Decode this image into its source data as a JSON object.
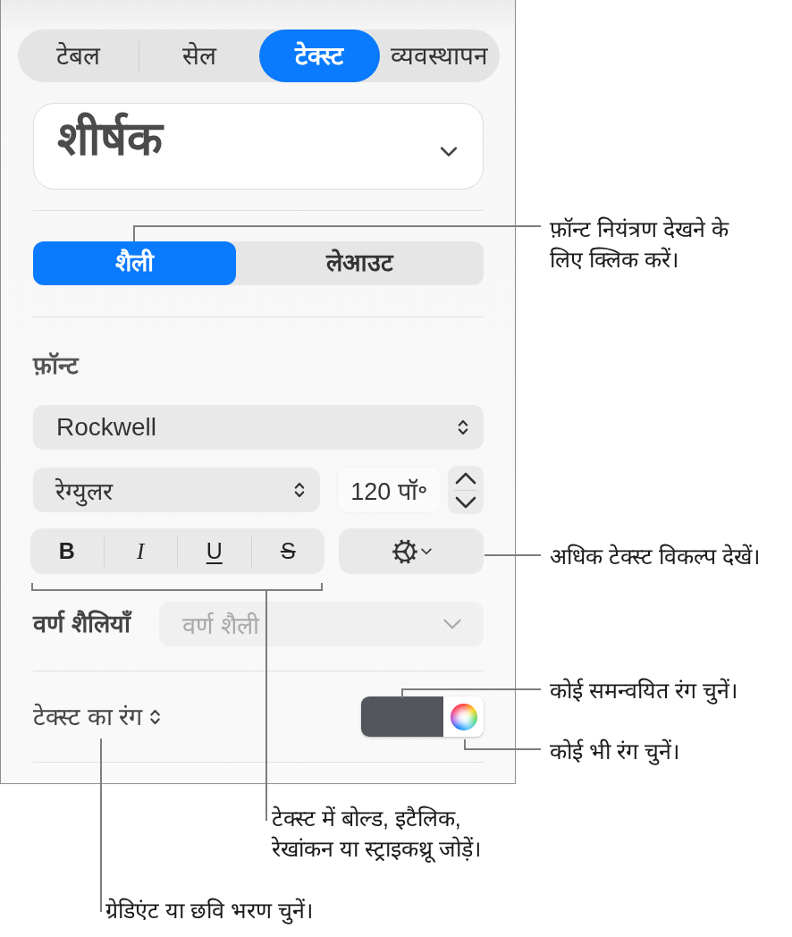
{
  "inspector": {
    "tabs": [
      {
        "label": "टेबल",
        "selected": false
      },
      {
        "label": "सेल",
        "selected": false
      },
      {
        "label": "टेक्स्ट",
        "selected": true
      },
      {
        "label": "व्यवस्थापन",
        "selected": false
      }
    ],
    "paragraph_style": {
      "value": "शीर्षक"
    },
    "subtabs": [
      {
        "label": "शैली",
        "selected": true
      },
      {
        "label": "लेआउट",
        "selected": false
      }
    ],
    "font_section": {
      "label": "फ़ॉन्ट",
      "font": "Rockwell",
      "typeface": "रेग्युलर",
      "size": "120 पॉ॰"
    },
    "format_buttons": [
      {
        "label": "B",
        "kind": "bold"
      },
      {
        "label": "I",
        "kind": "italic"
      },
      {
        "label": "U",
        "kind": "underline"
      },
      {
        "label": "S",
        "kind": "strikethrough"
      }
    ],
    "character_styles": {
      "label": "वर्ण शैलियाँ",
      "placeholder": "वर्ण शैली",
      "disabled": true
    },
    "text_color": {
      "label": "टेक्स्ट का रंग"
    }
  },
  "callouts": [
    {
      "text": "फ़ॉन्ट नियंत्रण देखने के लिए क्लिक करें।"
    },
    {
      "text": "अधिक टेक्स्ट विकल्प देखें।"
    },
    {
      "text": "कोई समन्वयित रंग चुनें।"
    },
    {
      "text": "कोई भी रंग चुनें।"
    },
    {
      "text": "टेक्स्ट में बोल्ड, इटैलिक, रेखांकन या स्ट्राइकथ्रू जोड़ें।"
    },
    {
      "text": "ग्रेडिएंट या छवि भरण चुनें।"
    }
  ]
}
